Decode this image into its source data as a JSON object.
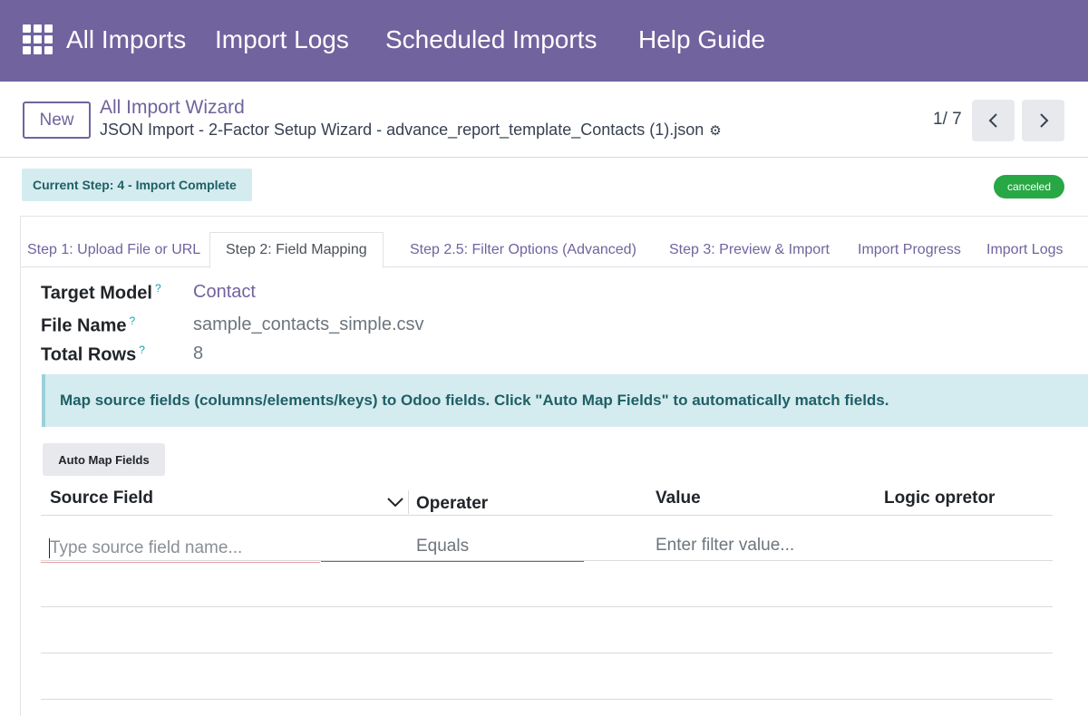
{
  "nav": {
    "items": [
      "All Imports",
      "Import Logs",
      "Scheduled Imports",
      "Help Guide"
    ]
  },
  "control": {
    "new_label": "New",
    "breadcrumb": "All Import Wizard",
    "record_name": "JSON Import - 2-Factor Setup Wizard - advance_report_template_Contacts (1).json",
    "pager": "1/ 7"
  },
  "status": {
    "current_step": "Current Step: 4 - Import Complete",
    "state": "canceled"
  },
  "tabs": [
    "Step 1: Upload File or URL",
    "Step 2: Field Mapping",
    "Step 2.5: Filter Options (Advanced)",
    "Step 3: Preview & Import",
    "Import Progress",
    "Import Logs"
  ],
  "fields": {
    "target_model": {
      "label": "Target Model",
      "value": "Contact",
      "help": "?"
    },
    "file_name": {
      "label": "File Name",
      "value": "sample_contacts_simple.csv",
      "help": "?"
    },
    "total_rows": {
      "label": "Total Rows",
      "value": "8",
      "help": "?"
    }
  },
  "alert": "Map source fields (columns/elements/keys) to Odoo fields. Click \"Auto Map Fields\" to automatically match fields.",
  "auto_map_label": "Auto Map Fields",
  "grid": {
    "columns": [
      "Source Field",
      "Operater",
      "Value",
      "Logic opretor"
    ],
    "row": {
      "source_placeholder": "Type source field name...",
      "operator": "Equals",
      "value_placeholder": "Enter filter value..."
    }
  },
  "colors": {
    "brand": "#71639e",
    "info_bg": "#d4ecef",
    "success": "#28a745"
  }
}
